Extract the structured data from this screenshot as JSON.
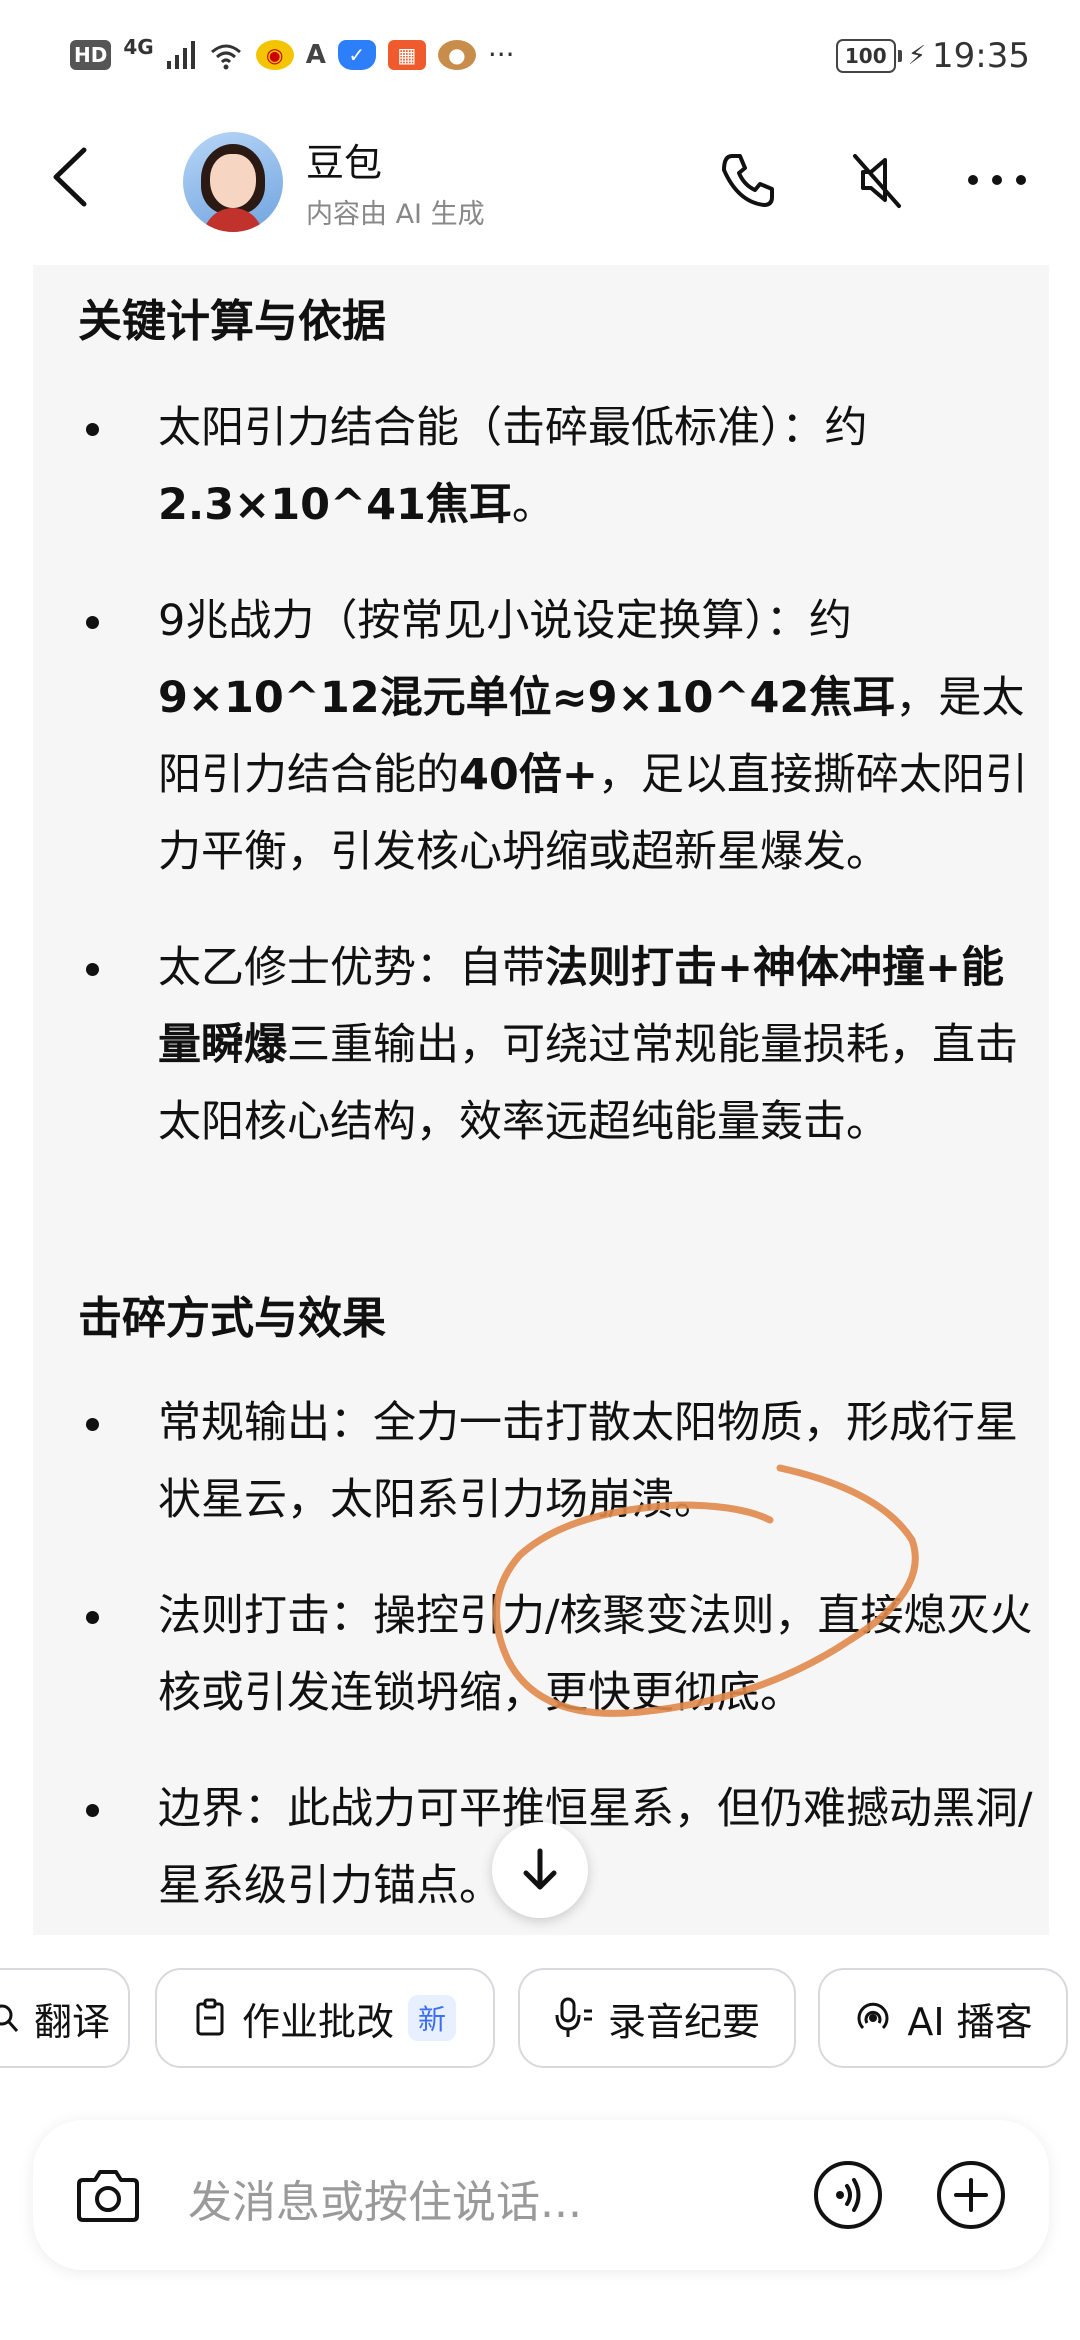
{
  "status_bar": {
    "icons": [
      "hd-icon",
      "signal-4g-icon",
      "signal-bars-icon",
      "wifi-6-icon",
      "weibo-icon",
      "a-app-icon",
      "shield-icon",
      "app-icon",
      "dog-avatar-icon",
      "more-dots-icon"
    ],
    "hd": "HD",
    "net": "4G",
    "wifi": "6",
    "dots": "···",
    "battery": "100",
    "time": "19:35"
  },
  "header": {
    "title": "豆包",
    "subtitle": "内容由 AI 生成"
  },
  "content": {
    "section1_title": "关键计算与依据",
    "bullet1": {
      "p1": "太阳引力结合能（击碎最低标准）：约",
      "b1": "2.3×10^41焦耳",
      "p2": "。"
    },
    "bullet2": {
      "p1": "9兆战力（按常见小说设定换算）：约",
      "b1": "9×10^12混元单位≈9×10^42焦耳",
      "p2": "，是太阳引力结合能的",
      "b2": "40倍+",
      "p3": "，足以直接撕碎太阳引力平衡，引发核心坍缩或超新星爆发。"
    },
    "bullet3": {
      "p1": "太乙修士优势：自带",
      "b1": "法则打击+神体冲撞+能量瞬爆",
      "p2": "三重输出，可绕过常规能量损耗，直击太阳核心结构，效率远超纯能量轰击。"
    },
    "section2_title": "击碎方式与效果",
    "bullet4": "常规输出：全力一击打散太阳物质，形成行星状星云，太阳系引力场崩溃。",
    "bullet5": "法则打击：操控引力/核聚变法则，直接熄灭火核或引发连锁坍缩，更快更彻底。",
    "bullet6": "边界：此战力可平推恒星系，但仍难撼动黑洞/星系级引力锚点。"
  },
  "chips": {
    "translate": "翻译",
    "homework": "作业批改",
    "new_badge": "新",
    "recording": "录音纪要",
    "podcast": "AI 播客"
  },
  "input": {
    "placeholder": "发消息或按住说话..."
  },
  "colors": {
    "accent_orange": "#e08a4a",
    "card_bg": "#f6f6f7",
    "badge_blue": "#3b6ff5"
  }
}
